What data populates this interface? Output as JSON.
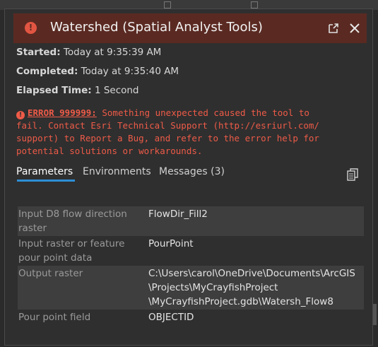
{
  "window": {
    "title": "Watershed (Spatial Analyst Tools)",
    "status": "error",
    "accent_color": "#5a2a22",
    "error_color": "#ee5b48",
    "icons": {
      "status": "error-icon",
      "popout": "popout-icon",
      "close": "close-icon",
      "copy": "copy-icon"
    }
  },
  "meta": {
    "started_label": "Started:",
    "started_value": "Today at 9:35:39 AM",
    "completed_label": "Completed:",
    "completed_value": "Today at 9:35:40 AM",
    "elapsed_label": "Elapsed Time:",
    "elapsed_value": "1 Second"
  },
  "error": {
    "code": "ERROR 999999:",
    "lines": [
      " Something unexpected caused the tool to",
      "fail. Contact Esri Technical Support (http://esriurl.com/",
      "support) to Report a Bug, and refer to the error help for",
      "potential solutions or workarounds."
    ]
  },
  "tabs": [
    {
      "label": "Parameters",
      "active": true
    },
    {
      "label": "Environments",
      "active": false
    },
    {
      "label": "Messages (3)",
      "active": false
    }
  ],
  "parameters": [
    {
      "name_lines": [
        "Input D8 flow direction",
        "raster"
      ],
      "value_lines": [
        "FlowDir_Fill2"
      ]
    },
    {
      "name_lines": [
        "Input raster or feature",
        "pour point data"
      ],
      "value_lines": [
        "PourPoint"
      ]
    },
    {
      "name_lines": [
        "Output raster"
      ],
      "value_lines": [
        "C:\\Users\\carol\\OneDrive\\Documents\\ArcGIS",
        "\\Projects\\MyCrayfishProject",
        "\\MyCrayfishProject.gdb\\Watersh_Flow8"
      ]
    },
    {
      "name_lines": [
        "Pour point field"
      ],
      "value_lines": [
        "OBJECTID"
      ]
    }
  ]
}
